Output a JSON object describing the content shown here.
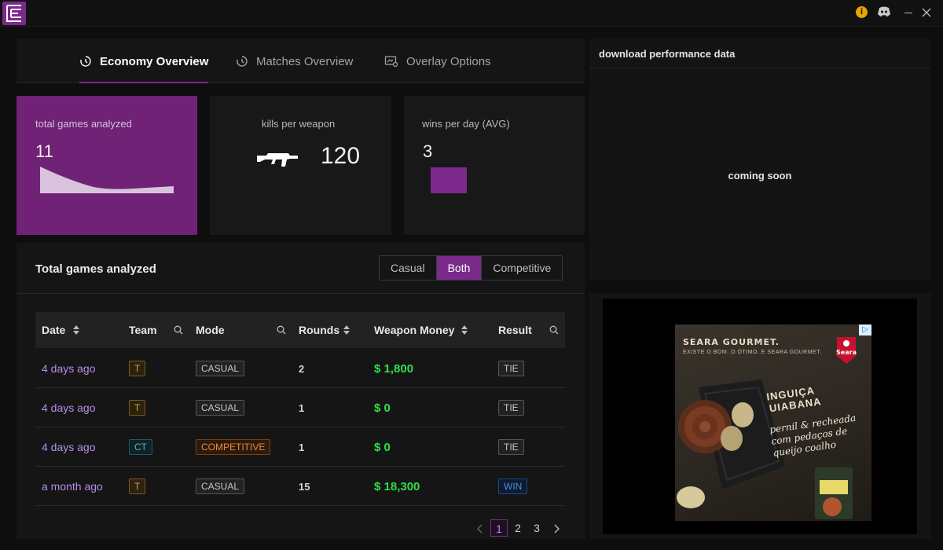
{
  "titlebar": {
    "icons": [
      "app-logo",
      "info-icon",
      "discord-icon",
      "minimize-icon",
      "close-icon"
    ]
  },
  "tabs": [
    {
      "label": "Economy Overview",
      "icon": "clock-icon",
      "active": true
    },
    {
      "label": "Matches Overview",
      "icon": "clock-icon",
      "active": false
    },
    {
      "label": "Overlay Options",
      "icon": "overlay-icon",
      "active": false
    }
  ],
  "cards": {
    "games": {
      "title": "total games analyzed",
      "value": "11"
    },
    "kills": {
      "title": "kills per weapon",
      "value": "120",
      "icon": "rifle-icon"
    },
    "wins": {
      "title": "wins per day (AVG)",
      "value": "3"
    }
  },
  "table": {
    "title": "Total games analyzed",
    "filters": [
      "Casual",
      "Both",
      "Competitive"
    ],
    "active_filter": "Both",
    "headers": {
      "date": "Date",
      "team": "Team",
      "mode": "Mode",
      "rounds": "Rounds",
      "money": "Weapon Money",
      "result": "Result"
    },
    "rows": [
      {
        "date": "4 days ago",
        "team": "T",
        "mode": "CASUAL",
        "rounds": "2",
        "money": "$ 1,800",
        "result": "TIE"
      },
      {
        "date": "4 days ago",
        "team": "T",
        "mode": "CASUAL",
        "rounds": "1",
        "money": "$ 0",
        "result": "TIE"
      },
      {
        "date": "4 days ago",
        "team": "CT",
        "mode": "COMPETITIVE",
        "rounds": "1",
        "money": "$ 0",
        "result": "TIE"
      },
      {
        "date": "a month ago",
        "team": "T",
        "mode": "CASUAL",
        "rounds": "15",
        "money": "$ 18,300",
        "result": "WIN"
      }
    ],
    "pagination": {
      "pages": [
        "1",
        "2",
        "3"
      ],
      "current": "1"
    }
  },
  "download": {
    "title": "download performance data",
    "status": "coming soon"
  },
  "ad": {
    "brand": "SEARA GOURMET.",
    "tagline": "EXISTE O BOM. O ÓTIMO. E SEARA GOURMET.",
    "logo": "Seara",
    "product": "LINGUIÇA CUIABANA",
    "copy": "pernil & recheada com pedaços de queijo coalho"
  },
  "colors": {
    "accent": "#7b2a8c",
    "money": "#2fe04a",
    "date": "#b48ee8"
  }
}
